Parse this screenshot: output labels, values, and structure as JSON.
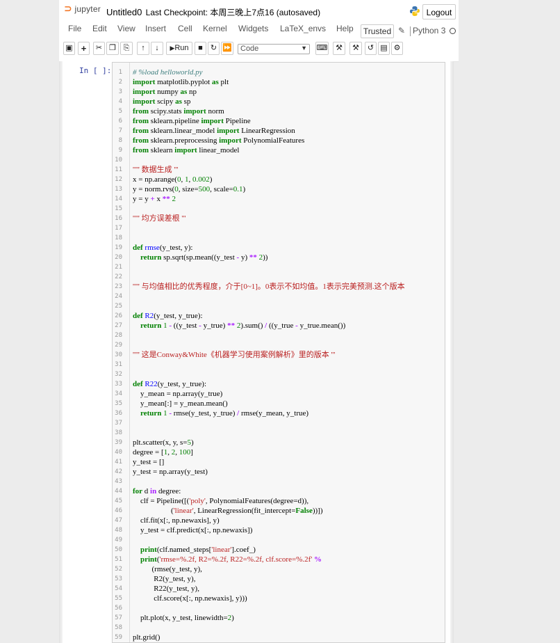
{
  "header": {
    "logo_text": "jupyter",
    "notebook_name": "Untitled0",
    "checkpoint": "Last Checkpoint: 本周三晚上7点16 (autosaved)",
    "logout_label": "Logout"
  },
  "menubar": {
    "items": [
      "File",
      "Edit",
      "View",
      "Insert",
      "Cell",
      "Kernel",
      "Widgets",
      "LaTeX_envs",
      "Help"
    ],
    "trusted_label": "Trusted",
    "kernel_name": "Python 3"
  },
  "toolbar": {
    "run_label": "Run",
    "cell_type": "Code"
  },
  "cell": {
    "prompt": "In [ ]:",
    "lines": [
      [
        [
          "c",
          "# %load helloworld.py"
        ]
      ],
      [
        [
          "k",
          "import"
        ],
        [
          "t",
          " matplotlib.pyplot "
        ],
        [
          "k",
          "as"
        ],
        [
          "t",
          " plt"
        ]
      ],
      [
        [
          "k",
          "import"
        ],
        [
          "t",
          " numpy "
        ],
        [
          "k",
          "as"
        ],
        [
          "t",
          " np"
        ]
      ],
      [
        [
          "k",
          "import"
        ],
        [
          "t",
          " scipy "
        ],
        [
          "k",
          "as"
        ],
        [
          "t",
          " sp"
        ]
      ],
      [
        [
          "k",
          "from"
        ],
        [
          "t",
          " scipy.stats "
        ],
        [
          "k",
          "import"
        ],
        [
          "t",
          " norm"
        ]
      ],
      [
        [
          "k",
          "from"
        ],
        [
          "t",
          " sklearn.pipeline "
        ],
        [
          "k",
          "import"
        ],
        [
          "t",
          " Pipeline"
        ]
      ],
      [
        [
          "k",
          "from"
        ],
        [
          "t",
          " sklearn.linear_model "
        ],
        [
          "k",
          "import"
        ],
        [
          "t",
          " LinearRegression"
        ]
      ],
      [
        [
          "k",
          "from"
        ],
        [
          "t",
          " sklearn.preprocessing "
        ],
        [
          "k",
          "import"
        ],
        [
          "t",
          " PolynomialFeatures"
        ]
      ],
      [
        [
          "k",
          "from"
        ],
        [
          "t",
          " sklearn "
        ],
        [
          "k",
          "import"
        ],
        [
          "t",
          " linear_model"
        ]
      ],
      [],
      [
        [
          "s",
          "''''' 数据生成 '''"
        ]
      ],
      [
        [
          "t",
          "x = np.arange("
        ],
        [
          "n",
          "0"
        ],
        [
          "t",
          ", "
        ],
        [
          "n",
          "1"
        ],
        [
          "t",
          ", "
        ],
        [
          "n",
          "0.002"
        ],
        [
          "t",
          ")"
        ]
      ],
      [
        [
          "t",
          "y = norm.rvs("
        ],
        [
          "n",
          "0"
        ],
        [
          "t",
          ", size="
        ],
        [
          "n",
          "500"
        ],
        [
          "t",
          ", scale="
        ],
        [
          "n",
          "0.1"
        ],
        [
          "t",
          ")"
        ]
      ],
      [
        [
          "t",
          "y = y "
        ],
        [
          "o",
          "+"
        ],
        [
          "t",
          " x "
        ],
        [
          "o",
          "**"
        ],
        [
          "t",
          " "
        ],
        [
          "n",
          "2"
        ]
      ],
      [],
      [
        [
          "s",
          "''''' 均方误差根 '''"
        ]
      ],
      [],
      [],
      [
        [
          "k",
          "def"
        ],
        [
          "t",
          " "
        ],
        [
          "d",
          "rmse"
        ],
        [
          "t",
          "(y_test, y):"
        ]
      ],
      [
        [
          "t",
          "    "
        ],
        [
          "k",
          "return"
        ],
        [
          "t",
          " sp.sqrt(sp.mean((y_test "
        ],
        [
          "o",
          "-"
        ],
        [
          "t",
          " y) "
        ],
        [
          "o",
          "**"
        ],
        [
          "t",
          " "
        ],
        [
          "n",
          "2"
        ],
        [
          "t",
          "))"
        ]
      ],
      [],
      [],
      [
        [
          "s",
          "''''' 与均值相比的优秀程度，介于[0~1]。0表示不如均值。1表示完美预测.这个版本"
        ]
      ],
      [],
      [],
      [
        [
          "k",
          "def"
        ],
        [
          "t",
          " "
        ],
        [
          "d",
          "R2"
        ],
        [
          "t",
          "(y_test, y_true):"
        ]
      ],
      [
        [
          "t",
          "    "
        ],
        [
          "k",
          "return"
        ],
        [
          "t",
          " "
        ],
        [
          "n",
          "1"
        ],
        [
          "t",
          " "
        ],
        [
          "o",
          "-"
        ],
        [
          "t",
          " ((y_test "
        ],
        [
          "o",
          "-"
        ],
        [
          "t",
          " y_true) "
        ],
        [
          "o",
          "**"
        ],
        [
          "t",
          " "
        ],
        [
          "n",
          "2"
        ],
        [
          "t",
          ").sum() "
        ],
        [
          "o",
          "/"
        ],
        [
          "t",
          " ((y_true "
        ],
        [
          "o",
          "-"
        ],
        [
          "t",
          " y_true.mean())"
        ]
      ],
      [],
      [],
      [
        [
          "s",
          "''''' 这是Conway&White《机器学习使用案例解析》里的版本 '''"
        ]
      ],
      [],
      [],
      [
        [
          "k",
          "def"
        ],
        [
          "t",
          " "
        ],
        [
          "d",
          "R22"
        ],
        [
          "t",
          "(y_test, y_true):"
        ]
      ],
      [
        [
          "t",
          "    y_mean = np.array(y_true)"
        ]
      ],
      [
        [
          "t",
          "    y_mean[:] = y_mean.mean()"
        ]
      ],
      [
        [
          "t",
          "    "
        ],
        [
          "k",
          "return"
        ],
        [
          "t",
          " "
        ],
        [
          "n",
          "1"
        ],
        [
          "t",
          " "
        ],
        [
          "o",
          "-"
        ],
        [
          "t",
          " rmse(y_test, y_true) "
        ],
        [
          "o",
          "/"
        ],
        [
          "t",
          " rmse(y_mean, y_true)"
        ]
      ],
      [],
      [],
      [
        [
          "t",
          "plt.scatter(x, y, s="
        ],
        [
          "n",
          "5"
        ],
        [
          "t",
          ")"
        ]
      ],
      [
        [
          "t",
          "degree = ["
        ],
        [
          "n",
          "1"
        ],
        [
          "t",
          ", "
        ],
        [
          "n",
          "2"
        ],
        [
          "t",
          ", "
        ],
        [
          "n",
          "100"
        ],
        [
          "t",
          "]"
        ]
      ],
      [
        [
          "t",
          "y_test = []"
        ]
      ],
      [
        [
          "t",
          "y_test = np.array(y_test)"
        ]
      ],
      [],
      [
        [
          "k",
          "for"
        ],
        [
          "t",
          " d "
        ],
        [
          "o",
          "in"
        ],
        [
          "t",
          " degree:"
        ]
      ],
      [
        [
          "t",
          "    clf = Pipeline([("
        ],
        [
          "s",
          "'poly'"
        ],
        [
          "t",
          ", PolynomialFeatures(degree=d)),"
        ]
      ],
      [
        [
          "t",
          "                    ("
        ],
        [
          "s",
          "'linear'"
        ],
        [
          "t",
          ", LinearRegression(fit_intercept="
        ],
        [
          "k",
          "False"
        ],
        [
          "t",
          "))])"
        ]
      ],
      [
        [
          "t",
          "    clf.fit(x[:, np.newaxis], y)"
        ]
      ],
      [
        [
          "t",
          "    y_test = clf.predict(x[:, np.newaxis])"
        ]
      ],
      [],
      [
        [
          "t",
          "    "
        ],
        [
          "k",
          "print"
        ],
        [
          "t",
          "(clf.named_steps["
        ],
        [
          "s",
          "'linear'"
        ],
        [
          "t",
          "].coef_)"
        ]
      ],
      [
        [
          "t",
          "    "
        ],
        [
          "k",
          "print"
        ],
        [
          "t",
          "("
        ],
        [
          "s",
          "'rmse=%.2f, R2=%.2f, R22=%.2f, clf.score=%.2f'"
        ],
        [
          "t",
          " "
        ],
        [
          "o",
          "%"
        ]
      ],
      [
        [
          "t",
          "          (rmse(y_test, y),"
        ]
      ],
      [
        [
          "t",
          "           R2(y_test, y),"
        ]
      ],
      [
        [
          "t",
          "           R22(y_test, y),"
        ]
      ],
      [
        [
          "t",
          "           clf.score(x[:, np.newaxis], y)))"
        ]
      ],
      [],
      [
        [
          "t",
          "    plt.plot(x, y_test, linewidth="
        ],
        [
          "n",
          "2"
        ],
        [
          "t",
          ")"
        ]
      ],
      [],
      [
        [
          "t",
          "plt.grid()"
        ]
      ]
    ]
  },
  "colors": {
    "keyword": "#008000",
    "string": "#ba2121",
    "comment": "#408080",
    "operator": "#aa22ff",
    "function_def": "#0000ff",
    "prompt": "#303f9f"
  }
}
